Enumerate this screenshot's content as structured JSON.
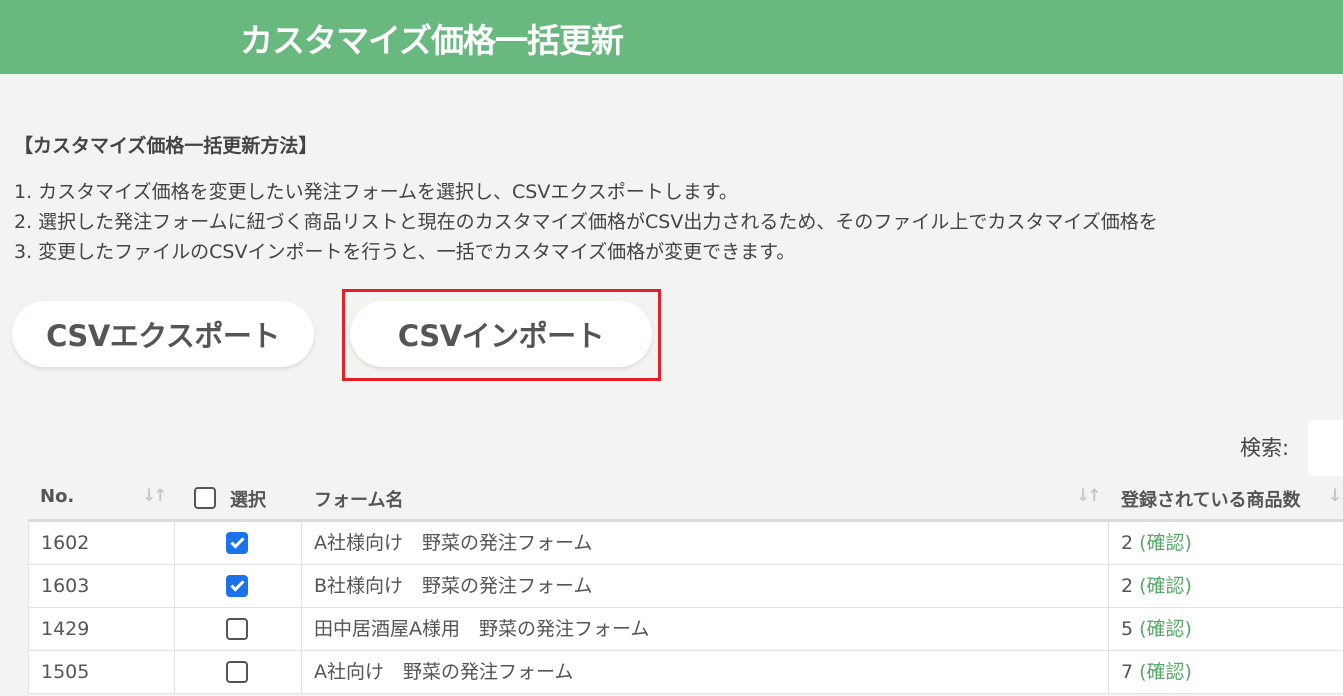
{
  "header": {
    "title": "カスタマイズ価格一括更新"
  },
  "method": {
    "heading": "【カスタマイズ価格一括更新方法】",
    "steps": [
      "1. カスタマイズ価格を変更したい発注フォームを選択し、CSVエクスポートします。",
      "2. 選択した発注フォームに紐づく商品リストと現在のカスタマイズ価格がCSV出力されるため、そのファイル上でカスタマイズ価格を",
      "3. 変更したファイルのCSVインポートを行うと、一括でカスタマイズ価格が変更できます。"
    ]
  },
  "buttons": {
    "export_label": "CSVエクスポート",
    "import_label": "CSVインポート"
  },
  "search": {
    "label": "検索:",
    "value": ""
  },
  "table": {
    "headers": {
      "no": "No.",
      "select": "選択",
      "form_name": "フォーム名",
      "product_count": "登録されている商品数"
    },
    "rows": [
      {
        "no": "1602",
        "checked": true,
        "form_name": "A社様向け　野菜の発注フォーム",
        "count": "2",
        "confirm": "(確認)"
      },
      {
        "no": "1603",
        "checked": true,
        "form_name": "B社様向け　野菜の発注フォーム",
        "count": "2",
        "confirm": "(確認)"
      },
      {
        "no": "1429",
        "checked": false,
        "form_name": "田中居酒屋A様用　野菜の発注フォーム",
        "count": "5",
        "confirm": "(確認)"
      },
      {
        "no": "1505",
        "checked": false,
        "form_name": "A社向け　野菜の発注フォーム",
        "count": "7",
        "confirm": "(確認)"
      }
    ]
  },
  "colors": {
    "header_bg": "#68b87f",
    "page_bg": "#f2f4f2",
    "highlight": "#e0202a",
    "checkbox_checked": "#1a73e8",
    "link": "#58a86a"
  }
}
